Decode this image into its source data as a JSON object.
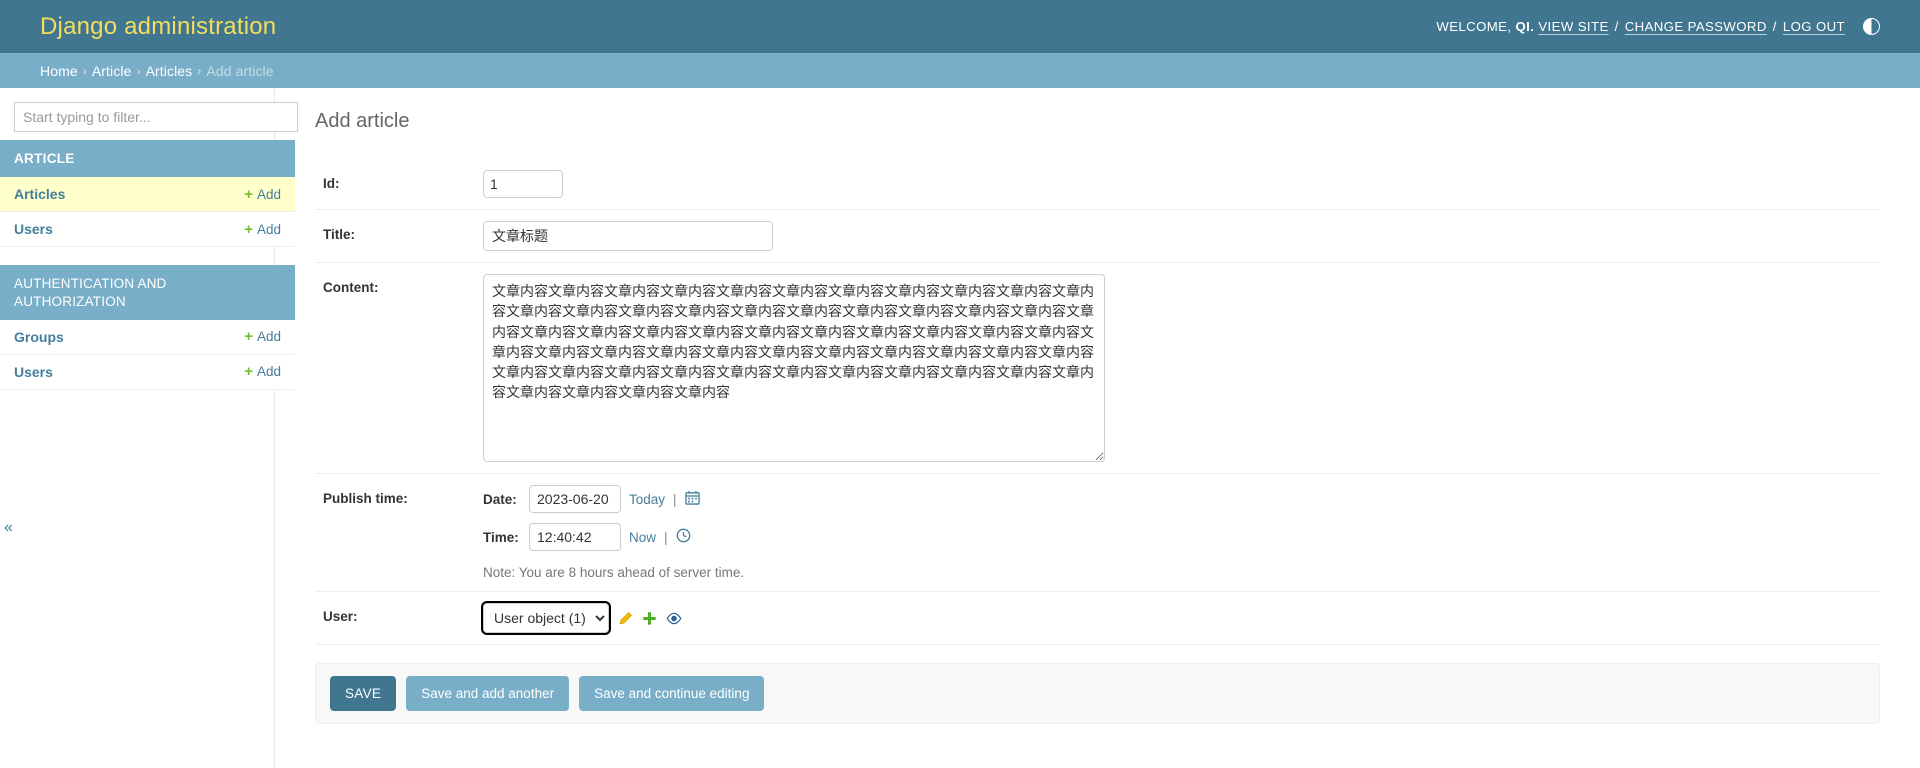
{
  "header": {
    "site_title": "Django administration",
    "welcome_prefix": "WELCOME,",
    "username": "QI.",
    "view_site": "VIEW SITE",
    "change_password": "CHANGE PASSWORD",
    "log_out": "LOG OUT",
    "separator": "/",
    "theme_toggle_icon": "theme-toggle-icon",
    "brand_color": "#f5dd5d",
    "header_bg": "#417690"
  },
  "breadcrumbs": {
    "items": [
      {
        "label": "Home",
        "current": false
      },
      {
        "label": "Article",
        "current": false
      },
      {
        "label": "Articles",
        "current": false
      },
      {
        "label": "Add article",
        "current": true
      }
    ],
    "separator": "›",
    "bg": "#79aec8"
  },
  "sidebar": {
    "filter_placeholder": "Start typing to filter...",
    "filter_value": "",
    "collapse_icon": "«",
    "apps": [
      {
        "caption": "ARTICLE",
        "models": [
          {
            "label": "Articles",
            "add_label": "Add",
            "current": true
          },
          {
            "label": "Users",
            "add_label": "Add",
            "current": false
          }
        ]
      },
      {
        "caption": "AUTHENTICATION AND AUTHORIZATION",
        "models": [
          {
            "label": "Groups",
            "add_label": "Add",
            "current": false
          },
          {
            "label": "Users",
            "add_label": "Add",
            "current": false
          }
        ]
      }
    ]
  },
  "main": {
    "page_title": "Add article",
    "fields": {
      "id": {
        "label": "Id:",
        "value": "1"
      },
      "title": {
        "label": "Title:",
        "value": "文章标题"
      },
      "content": {
        "label": "Content:",
        "value": "文章内容文章内容文章内容文章内容文章内容文章内容文章内容文章内容文章内容文章内容文章内容文章内容文章内容文章内容文章内容文章内容文章内容文章内容文章内容文章内容文章内容文章内容文章内容文章内容文章内容文章内容文章内容文章内容文章内容文章内容文章内容文章内容文章内容文章内容文章内容文章内容文章内容文章内容文章内容文章内容文章内容文章内容文章内容文章内容文章内容文章内容文章内容文章内容文章内容文章内容文章内容文章内容文章内容文章内容文章内容文章内容文章内容文章内容"
      },
      "publish_time": {
        "label": "Publish time:",
        "date_label": "Date:",
        "date_value": "2023-06-20",
        "today_label": "Today",
        "calendar_icon": "calendar-icon",
        "time_label": "Time:",
        "time_value": "12:40:42",
        "now_label": "Now",
        "clock_icon": "clock-icon",
        "pipe": "|",
        "timezone_note": "Note: You are 8 hours ahead of server time."
      },
      "user": {
        "label": "User:",
        "selected": "User object (1)",
        "options": [
          "User object (1)"
        ],
        "change_icon": "pencil-icon",
        "add_icon": "plus-icon",
        "view_icon": "eye-icon"
      }
    },
    "submit_row": {
      "save": "SAVE",
      "save_and_add_another": "Save and add another",
      "save_and_continue": "Save and continue editing"
    }
  }
}
